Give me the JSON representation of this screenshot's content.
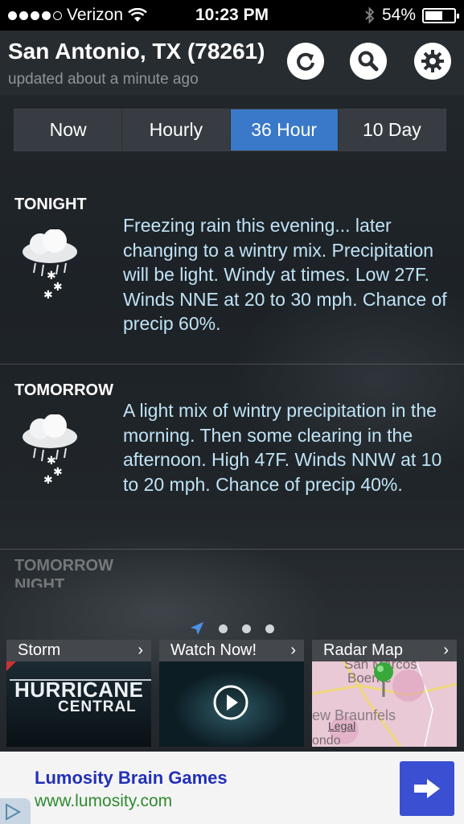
{
  "status_bar": {
    "carrier": "Verizon",
    "time": "10:23 PM",
    "battery": "54%",
    "battery_level": 0.54
  },
  "header": {
    "location": "San Antonio, TX (78261)",
    "updated": "updated about a minute ago"
  },
  "tabs": [
    {
      "label": "Now"
    },
    {
      "label": "Hourly"
    },
    {
      "label": "36 Hour",
      "active": true
    },
    {
      "label": "10 Day"
    }
  ],
  "forecast": [
    {
      "period": "TONIGHT",
      "icon": "wintry-mix-cloud-icon",
      "text": "Freezing rain this evening... later changing to a wintry mix. Precipitation will be light. Windy at times. Low 27F. Winds NNE at 20 to 30 mph. Chance of precip 60%."
    },
    {
      "period": "TOMORROW",
      "icon": "wintry-mix-cloud-icon",
      "text": "A light mix of wintry precipitation in the morning. Then some clearing in the afternoon. High 47F. Winds NNW at 10 to 20 mph. Chance of precip 40%."
    },
    {
      "period": "TOMORROW",
      "period_line2": "NIGHT"
    }
  ],
  "tiles": [
    {
      "label": "Storm",
      "art_line1": "HURRICANE",
      "art_line2": "CENTRAL"
    },
    {
      "label": "Watch Now!"
    },
    {
      "label": "Radar Map",
      "map_text1": "San Marcos",
      "map_text2": "Boerne",
      "map_text3": "ew Braunfels",
      "map_text4": "Legal",
      "map_text5": "ondo"
    }
  ],
  "ad": {
    "title": "Lumosity Brain Games",
    "url": "www.lumosity.com"
  },
  "colors": {
    "accent_tab": "#3a79c9",
    "forecast_text": "#bfe3f5",
    "ad_title": "#2230b8",
    "ad_url": "#2f8a2f"
  }
}
